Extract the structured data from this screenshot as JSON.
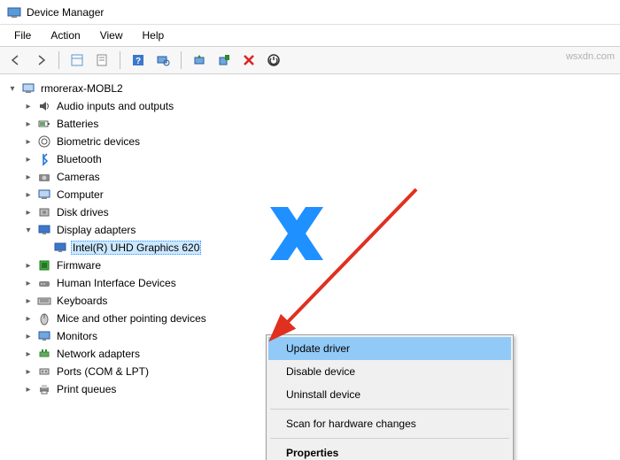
{
  "window": {
    "title": "Device Manager"
  },
  "menu": {
    "file": "File",
    "action": "Action",
    "view": "View",
    "help": "Help"
  },
  "tree": {
    "root": "rmorerax-MOBL2",
    "nodes": [
      "Audio inputs and outputs",
      "Batteries",
      "Biometric devices",
      "Bluetooth",
      "Cameras",
      "Computer",
      "Disk drives",
      "Display adapters",
      "Firmware",
      "Human Interface Devices",
      "Keyboards",
      "Mice and other pointing devices",
      "Monitors",
      "Network adapters",
      "Ports (COM & LPT)",
      "Print queues"
    ],
    "display_child": "Intel(R) UHD Graphics 620"
  },
  "context_menu": {
    "update": "Update driver",
    "disable": "Disable device",
    "uninstall": "Uninstall device",
    "scan": "Scan for hardware changes",
    "properties": "Properties"
  },
  "watermark": "wsxdn.com"
}
